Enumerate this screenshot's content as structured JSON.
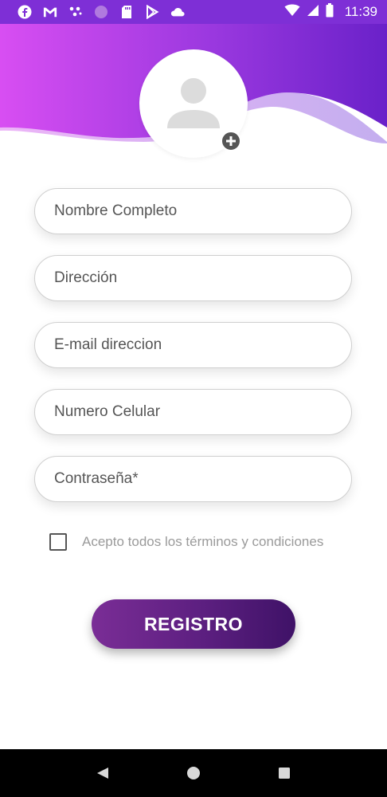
{
  "status_bar": {
    "time": "11:39",
    "left_icons": [
      "facebook-icon",
      "gmail-icon",
      "dots-icon",
      "circle-icon",
      "sd-card-icon",
      "play-store-icon",
      "cloud-icon"
    ],
    "right_icons": [
      "wifi-icon",
      "signal-icon",
      "battery-icon"
    ]
  },
  "colors": {
    "header_gradient_start": "#d84ef2",
    "header_gradient_end": "#6a21c9",
    "button_gradient_start": "#7a2d96",
    "button_gradient_end": "#3f1267"
  },
  "avatar": {
    "icon": "person-icon",
    "add_icon": "plus-icon"
  },
  "form": {
    "fields": [
      {
        "placeholder": "Nombre Completo",
        "value": ""
      },
      {
        "placeholder": "Dirección",
        "value": ""
      },
      {
        "placeholder": "E-mail direccion",
        "value": ""
      },
      {
        "placeholder": "Numero Celular",
        "value": ""
      },
      {
        "placeholder": "Contraseña*",
        "value": ""
      }
    ],
    "terms_label": "Acepto todos los términos y condiciones",
    "terms_checked": false,
    "submit_label": "REGISTRO"
  },
  "nav_bar": {
    "buttons": [
      "back-icon",
      "home-icon",
      "recents-icon"
    ]
  }
}
